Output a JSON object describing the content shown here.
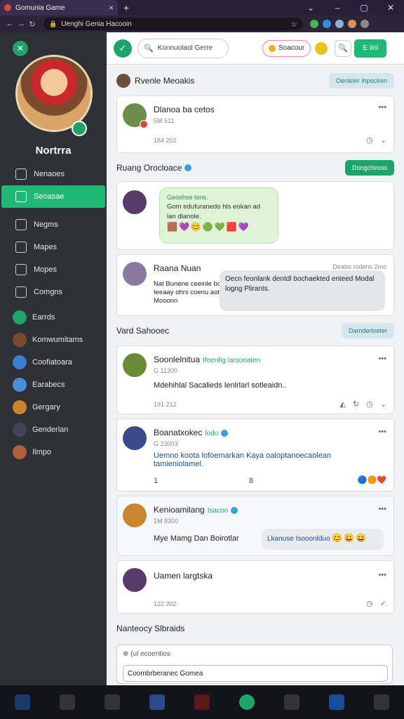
{
  "browser": {
    "tab_title": "Gomunia Game",
    "url": "Uenghi Genia Hacooin"
  },
  "sidebar": {
    "profile_name": "Nortrra",
    "menu": [
      "Nenaoes",
      "Seoasae",
      "Negms",
      "Mapes",
      "Mopes",
      "Comgns"
    ],
    "channels": [
      "Earrds",
      "Komwumitams",
      "Coofiatoara",
      "Earabecs",
      "Gergary",
      "Genderlan",
      "Ilmpo"
    ]
  },
  "topbar": {
    "search_text": "Konnuolaol Gerre",
    "pill_label": "Soacour",
    "button_label": "E iinl"
  },
  "sections": {
    "s1_title": "Rvenle Meoakis",
    "s1_pill": "Oenleler ihpoclren",
    "s2_title": "Ruang Orocloace",
    "s2_pill": "Dongchinoio",
    "s3_title": "Vard Sahooec",
    "s3_pill": "Darnderloeter",
    "s4_title": "Nanteocy Slbraids"
  },
  "cards": [
    {
      "name": "Dlanoa ba cetos",
      "meta": "5M 511",
      "time": "184 202"
    },
    {
      "bubble_head": "Geoohse tons.",
      "bubble_text": "Gom edufuranedo hls eokan ad lan dlanole."
    },
    {
      "name": "Raana Nuan",
      "meta": "Deabo rodens 2mo",
      "text_left": "Nat Bunene ceeinle boeionr teeaay ohrs coenu aot Mooonn",
      "text_right": "Oecn feonlank dentdl bochaekted enteed Modal logng Plirants."
    },
    {
      "name": "Soonlelnitua",
      "tag": "Ifeenfig larsoriaten",
      "meta": "G 11300",
      "body": "Mdehihlal Sacalieds lenlrlarl sotleaidn..",
      "time": "191 212"
    },
    {
      "name": "Boanatxokec",
      "tag": "lodo",
      "meta": "G 23003",
      "body": "Uemno koota lofoemarkan Kaya oaloptanoecaolean tamieniolamel.",
      "count": "1",
      "count2": "8"
    },
    {
      "name": "Kenioamilang",
      "tag": "Isacon",
      "meta": "1M 8300",
      "body": "Mye Mamg Dan Boirotlar",
      "reply": "Lkanuse Isooonlduo"
    },
    {
      "name": "Uamen largtska",
      "time": "122 202"
    }
  ],
  "composer": {
    "placeholder": "(ul ecoentios",
    "input_text": "Coombrberanec Gomea"
  }
}
